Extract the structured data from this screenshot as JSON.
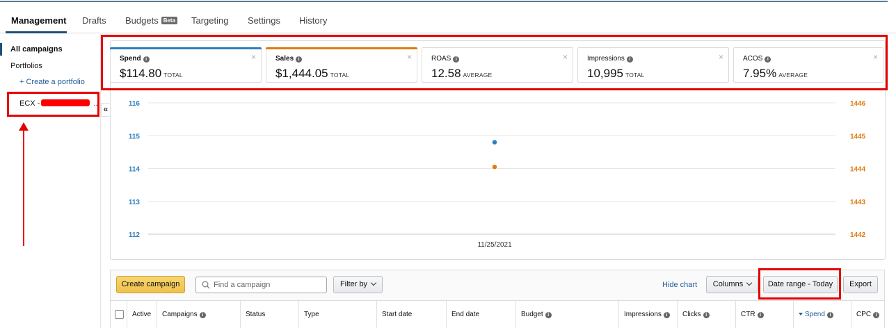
{
  "nav": {
    "tabs": [
      {
        "label": "Management",
        "active": true
      },
      {
        "label": "Drafts"
      },
      {
        "label": "Budgets",
        "badge": "Beta"
      },
      {
        "label": "Targeting"
      },
      {
        "label": "Settings"
      },
      {
        "label": "History"
      }
    ]
  },
  "sidebar": {
    "all_campaigns": "All campaigns",
    "portfolios": "Portfolios",
    "create_portfolio": "+ Create a portfolio",
    "portfolio_prefix": "ECX -",
    "portfolio_ellipsis": "...",
    "collapse_glyph": "«"
  },
  "metrics": [
    {
      "label": "Spend",
      "value": "$114.80",
      "unit": "TOTAL",
      "selected": true,
      "color": "#2e7ebd"
    },
    {
      "label": "Sales",
      "value": "$1,444.05",
      "unit": "TOTAL",
      "selected": true,
      "color": "#e07b10"
    },
    {
      "label": "ROAS",
      "value": "12.58",
      "unit": "AVERAGE",
      "selected": false
    },
    {
      "label": "Impressions",
      "value": "10,995",
      "unit": "TOTAL",
      "selected": false
    },
    {
      "label": "ACOS",
      "value": "7.95%",
      "unit": "AVERAGE",
      "selected": false
    }
  ],
  "chart_data": {
    "type": "scatter",
    "x": [
      "11/25/2021"
    ],
    "series": [
      {
        "name": "Spend",
        "axis": "left",
        "color": "#2e7ebd",
        "values": [
          114.8
        ]
      },
      {
        "name": "Sales",
        "axis": "right",
        "color": "#e07b10",
        "values": [
          1444.05
        ]
      }
    ],
    "y_left": {
      "ticks": [
        116,
        115,
        114,
        113,
        112
      ],
      "range": [
        112,
        116
      ]
    },
    "y_right": {
      "ticks": [
        1446,
        1445,
        1444,
        1443,
        1442
      ],
      "range": [
        1442,
        1446
      ]
    },
    "grid": true
  },
  "toolbar": {
    "create_campaign": "Create campaign",
    "search_placeholder": "Find a campaign",
    "filter_by": "Filter by",
    "hide_chart": "Hide chart",
    "columns": "Columns",
    "date_range": "Date range - Today",
    "export": "Export"
  },
  "table": {
    "columns": [
      "Active",
      "Campaigns",
      "Status",
      "Type",
      "Start date",
      "End date",
      "Budget",
      "Impressions",
      "Clicks",
      "CTR",
      "Spend",
      "CPC"
    ],
    "sorted_column": "Spend"
  }
}
